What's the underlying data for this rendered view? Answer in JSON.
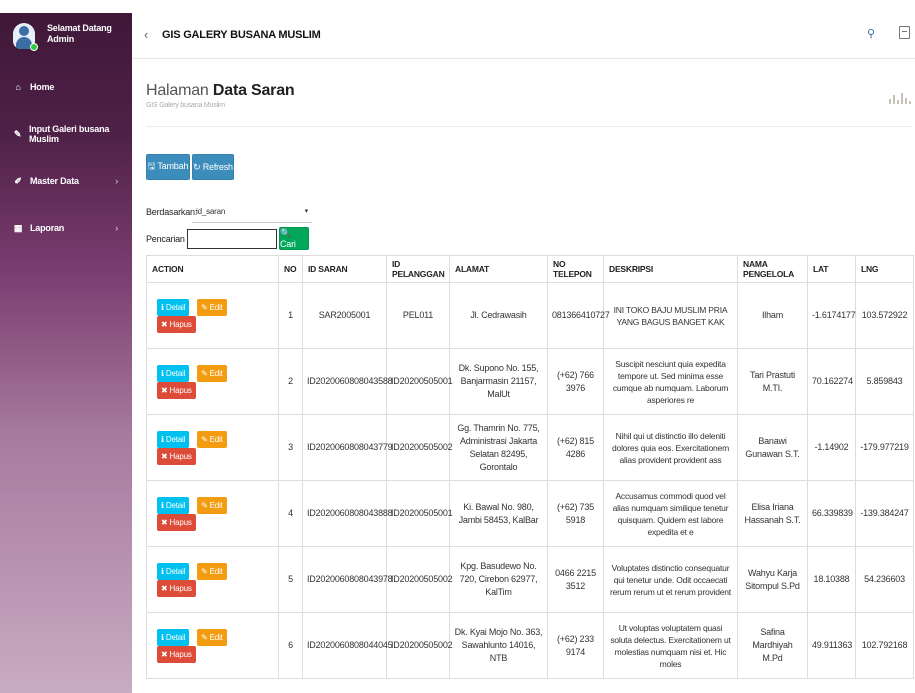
{
  "sidebar": {
    "greeting": "Selamat Datang",
    "user": "Admin",
    "items": [
      {
        "icon": "home-icon",
        "label": "Home",
        "chevron": ""
      },
      {
        "icon": "pencil-icon",
        "label": "Input Galeri busana Muslim",
        "chevron": ""
      },
      {
        "icon": "edit-icon",
        "label": "Master Data",
        "chevron": "›"
      },
      {
        "icon": "calendar-icon",
        "label": "Laporan",
        "chevron": "›"
      }
    ]
  },
  "topbar": {
    "back": "‹",
    "title": "GIS GALERY BUSANA MUSLIM",
    "pin": "⚲"
  },
  "page": {
    "title_light": "Halaman ",
    "title_bold": "Data Saran",
    "subtitle": "GIS Galery busana Muslim"
  },
  "toolbar": {
    "tambah": "🖫 Tambah",
    "refresh": "↻ Refresh"
  },
  "filter": {
    "by_label": "Berdasarkan:",
    "by_value": "id_saran",
    "caret": "▾",
    "search_label": "Pencarian",
    "search_value": "",
    "search_button": "🔍 Cari"
  },
  "table": {
    "headers": [
      "ACTION",
      "NO",
      "ID SARAN",
      "ID PELANGGAN",
      "ALAMAT",
      "NO TELEPON",
      "DESKRIPSI",
      "NAMA PENGELOLA",
      "LAT",
      "LNG"
    ],
    "actions": {
      "detail": "ℹ Detail",
      "edit": "✎ Edit",
      "hapus": "✖ Hapus"
    },
    "rows": [
      {
        "no": "1",
        "id_saran": "SAR2005001",
        "id_pelanggan": "PEL011",
        "alamat": "Jl. Cedrawasih",
        "telepon": "081366410727",
        "deskripsi": "INI TOKO BAJU MUSLIM PRIA YANG BAGUS BANGET KAK",
        "pengelola": "Ilham",
        "lat": "-1.6174177",
        "lng": "103.572922"
      },
      {
        "no": "2",
        "id_saran": "ID2020060808043588",
        "id_pelanggan": "ID20200505001",
        "alamat": "Dk. Supono No. 155, Banjarmasin 21157, MalUt",
        "telepon": "(+62) 766 3976",
        "deskripsi": "Suscipit nesciunt quia expedita tempore ut. Sed minima esse cumque ab numquam. Laborum asperiores re",
        "pengelola": "Tari Prastuti M.TI.",
        "lat": "70.162274",
        "lng": "5.859843"
      },
      {
        "no": "3",
        "id_saran": "ID2020060808043779",
        "id_pelanggan": "ID20200505002",
        "alamat": "Gg. Thamrin No. 775, Administrasi Jakarta Selatan 82495, Gorontalo",
        "telepon": "(+62) 815 4286",
        "deskripsi": "Nihil qui ut distinctio illo deleniti dolores quia eos. Exercitationem alias provident provident ass",
        "pengelola": "Banawi Gunawan S.T.",
        "lat": "-1.14902",
        "lng": "-179.977219"
      },
      {
        "no": "4",
        "id_saran": "ID2020060808043888",
        "id_pelanggan": "ID20200505001",
        "alamat": "Ki. Bawal No. 980, Jambi 58453, KalBar",
        "telepon": "(+62) 735 5918",
        "deskripsi": "Accusamus commodi quod vel alias numquam similique tenetur quisquam. Quidem est labore expedita et e",
        "pengelola": "Elisa Iriana Hassanah S.T.",
        "lat": "66.339839",
        "lng": "-139.384247"
      },
      {
        "no": "5",
        "id_saran": "ID2020060808043978",
        "id_pelanggan": "ID20200505002",
        "alamat": "Kpg. Basudewo No. 720, Cirebon 62977, KalTim",
        "telepon": "0466 2215 3512",
        "deskripsi": "Voluptates distinctio consequatur qui tenetur unde. Odit occaecati rerum rerum ut et rerum provident",
        "pengelola": "Wahyu Karja Sitompul S.Pd",
        "lat": "18.10388",
        "lng": "54.236603"
      },
      {
        "no": "6",
        "id_saran": "ID2020060808044045",
        "id_pelanggan": "ID20200505002",
        "alamat": "Dk. Kyai Mojo No. 363, Sawahlunto 14016, NTB",
        "telepon": "(+62) 233 9174",
        "deskripsi": "Ut voluptas voluptatem quasi soluta delectus. Exercitationem ut molestias numquam nisi et. Hic moles",
        "pengelola": "Safina Mardhiyah M.Pd",
        "lat": "49.911363",
        "lng": "102.792168"
      }
    ]
  }
}
